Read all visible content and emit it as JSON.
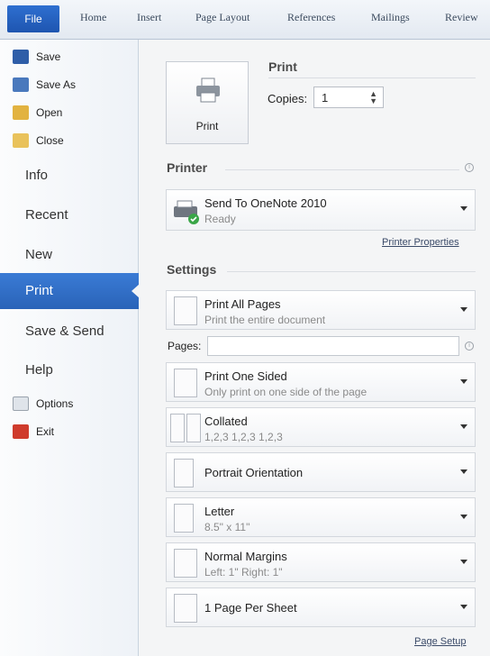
{
  "ribbon": {
    "file": "File",
    "tabs": [
      "Home",
      "Insert",
      "Page Layout",
      "References",
      "Mailings",
      "Review"
    ]
  },
  "nav": {
    "commands": [
      "Save",
      "Save As",
      "Open",
      "Close"
    ],
    "info": "Info",
    "recent": "Recent",
    "new": "New",
    "print": "Print",
    "save_send": "Save & Send",
    "help": "Help",
    "options": "Options",
    "exit": "Exit"
  },
  "print": {
    "heading": "Print",
    "button_label": "Print",
    "copies_label": "Copies:",
    "copies_value": "1"
  },
  "printer": {
    "heading": "Printer",
    "name": "Send To OneNote 2010",
    "status": "Ready",
    "properties_link": "Printer Properties"
  },
  "settings": {
    "heading": "Settings",
    "pages_label": "Pages:",
    "pages_value": "",
    "items": [
      {
        "title": "Print All Pages",
        "subtitle": "Print the entire document"
      },
      {
        "title": "Print One Sided",
        "subtitle": "Only print on one side of the page"
      },
      {
        "title": "Collated",
        "subtitle": "1,2,3   1,2,3   1,2,3"
      },
      {
        "title": "Portrait Orientation",
        "subtitle": ""
      },
      {
        "title": "Letter",
        "subtitle": "8.5\" x 11\""
      },
      {
        "title": "Normal Margins",
        "subtitle": "Left: 1\"   Right: 1\""
      },
      {
        "title": "1 Page Per Sheet",
        "subtitle": ""
      }
    ],
    "page_setup_link": "Page Setup"
  },
  "colors": {
    "accent": "#2a63b8",
    "file_tab": "#1e55b0"
  }
}
